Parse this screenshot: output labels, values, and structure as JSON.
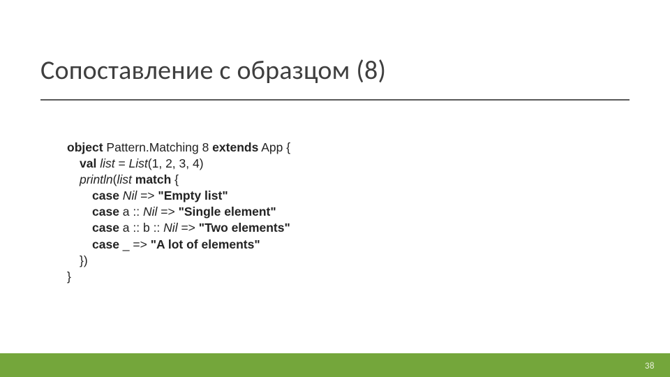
{
  "slide": {
    "title": "Сопоставление с образцом (8)",
    "page_number": "38"
  },
  "code": {
    "kw_object": "object",
    "obj_name": " Pattern.Matching 8 ",
    "kw_extends": "extends",
    "extends_tail": " App {",
    "kw_val": "val",
    "val_name": " list ",
    "eq": "= ",
    "list_ctor": "List",
    "list_args": "(1, 2, 3, 4)",
    "println_name": "println",
    "println_open": "(",
    "list_ref": "list",
    "space": " ",
    "kw_match": "match",
    "match_open": " {",
    "kw_case": "case",
    "nil": " Nil ",
    "arrow": "=> ",
    "str_empty": "\"Empty list\"",
    "pat_single_a": " a :: ",
    "nil_plain": "Nil ",
    "str_single": "\"Single element\"",
    "pat_two": " a :: b :: ",
    "str_two": "\"Two elements\"",
    "pat_wild": " _ ",
    "str_many": "\"A lot of elements\"",
    "close_paren": "})",
    "close_brace": "}"
  }
}
